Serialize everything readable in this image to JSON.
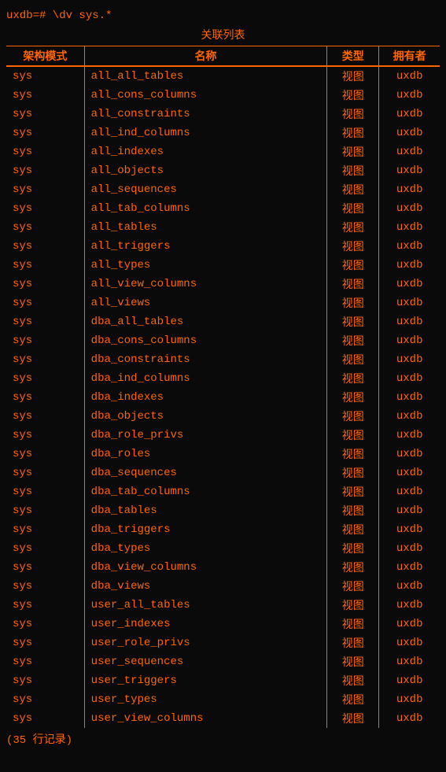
{
  "terminal": {
    "command": "uxdb=# \\dv sys.*",
    "table_title": "关联列表",
    "columns": {
      "schema": "架构模式",
      "name": "名称",
      "type": "类型",
      "owner": "拥有者"
    },
    "rows": [
      {
        "schema": "sys",
        "name": "all_all_tables",
        "type": "视图",
        "owner": "uxdb"
      },
      {
        "schema": "sys",
        "name": "all_cons_columns",
        "type": "视图",
        "owner": "uxdb"
      },
      {
        "schema": "sys",
        "name": "all_constraints",
        "type": "视图",
        "owner": "uxdb"
      },
      {
        "schema": "sys",
        "name": "all_ind_columns",
        "type": "视图",
        "owner": "uxdb"
      },
      {
        "schema": "sys",
        "name": "all_indexes",
        "type": "视图",
        "owner": "uxdb"
      },
      {
        "schema": "sys",
        "name": "all_objects",
        "type": "视图",
        "owner": "uxdb"
      },
      {
        "schema": "sys",
        "name": "all_sequences",
        "type": "视图",
        "owner": "uxdb"
      },
      {
        "schema": "sys",
        "name": "all_tab_columns",
        "type": "视图",
        "owner": "uxdb"
      },
      {
        "schema": "sys",
        "name": "all_tables",
        "type": "视图",
        "owner": "uxdb"
      },
      {
        "schema": "sys",
        "name": "all_triggers",
        "type": "视图",
        "owner": "uxdb"
      },
      {
        "schema": "sys",
        "name": "all_types",
        "type": "视图",
        "owner": "uxdb"
      },
      {
        "schema": "sys",
        "name": "all_view_columns",
        "type": "视图",
        "owner": "uxdb"
      },
      {
        "schema": "sys",
        "name": "all_views",
        "type": "视图",
        "owner": "uxdb"
      },
      {
        "schema": "sys",
        "name": "dba_all_tables",
        "type": "视图",
        "owner": "uxdb"
      },
      {
        "schema": "sys",
        "name": "dba_cons_columns",
        "type": "视图",
        "owner": "uxdb"
      },
      {
        "schema": "sys",
        "name": "dba_constraints",
        "type": "视图",
        "owner": "uxdb"
      },
      {
        "schema": "sys",
        "name": "dba_ind_columns",
        "type": "视图",
        "owner": "uxdb"
      },
      {
        "schema": "sys",
        "name": "dba_indexes",
        "type": "视图",
        "owner": "uxdb"
      },
      {
        "schema": "sys",
        "name": "dba_objects",
        "type": "视图",
        "owner": "uxdb"
      },
      {
        "schema": "sys",
        "name": "dba_role_privs",
        "type": "视图",
        "owner": "uxdb"
      },
      {
        "schema": "sys",
        "name": "dba_roles",
        "type": "视图",
        "owner": "uxdb"
      },
      {
        "schema": "sys",
        "name": "dba_sequences",
        "type": "视图",
        "owner": "uxdb"
      },
      {
        "schema": "sys",
        "name": "dba_tab_columns",
        "type": "视图",
        "owner": "uxdb"
      },
      {
        "schema": "sys",
        "name": "dba_tables",
        "type": "视图",
        "owner": "uxdb"
      },
      {
        "schema": "sys",
        "name": "dba_triggers",
        "type": "视图",
        "owner": "uxdb"
      },
      {
        "schema": "sys",
        "name": "dba_types",
        "type": "视图",
        "owner": "uxdb"
      },
      {
        "schema": "sys",
        "name": "dba_view_columns",
        "type": "视图",
        "owner": "uxdb"
      },
      {
        "schema": "sys",
        "name": "dba_views",
        "type": "视图",
        "owner": "uxdb"
      },
      {
        "schema": "sys",
        "name": "user_all_tables",
        "type": "视图",
        "owner": "uxdb"
      },
      {
        "schema": "sys",
        "name": "user_indexes",
        "type": "视图",
        "owner": "uxdb"
      },
      {
        "schema": "sys",
        "name": "user_role_privs",
        "type": "视图",
        "owner": "uxdb"
      },
      {
        "schema": "sys",
        "name": "user_sequences",
        "type": "视图",
        "owner": "uxdb"
      },
      {
        "schema": "sys",
        "name": "user_triggers",
        "type": "视图",
        "owner": "uxdb"
      },
      {
        "schema": "sys",
        "name": "user_types",
        "type": "视图",
        "owner": "uxdb"
      },
      {
        "schema": "sys",
        "name": "user_view_columns",
        "type": "视图",
        "owner": "uxdb"
      }
    ],
    "footer": "(35 行记录)"
  }
}
